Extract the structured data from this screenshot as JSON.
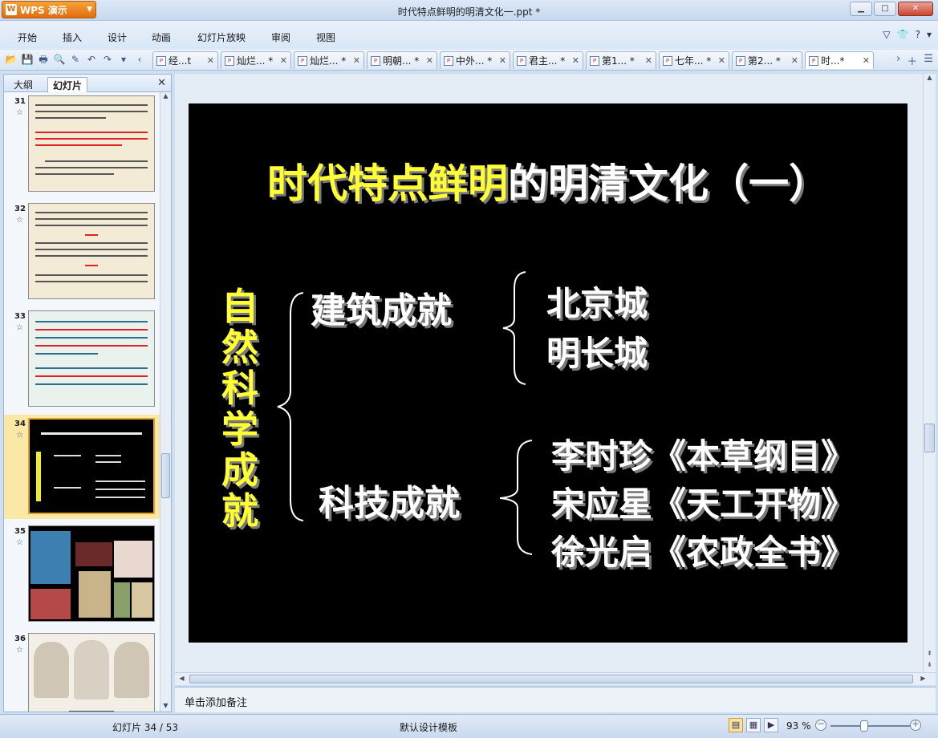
{
  "app": {
    "name": "WPS 演示",
    "document_title": "时代特点鲜明的明清文化一.ppt *"
  },
  "window_controls": {
    "minimize": "▁",
    "maximize": "□",
    "close": "✕"
  },
  "menu": [
    "开始",
    "插入",
    "设计",
    "动画",
    "幻灯片放映",
    "审阅",
    "视图"
  ],
  "doc_tabs": [
    {
      "label": "经...t",
      "active": false
    },
    {
      "label": "灿烂... *",
      "active": false
    },
    {
      "label": "灿烂... *",
      "active": false
    },
    {
      "label": "明朝... *",
      "active": false
    },
    {
      "label": "中外... *",
      "active": false
    },
    {
      "label": "君主... *",
      "active": false
    },
    {
      "label": "第1... *",
      "active": false
    },
    {
      "label": "七年... *",
      "active": false
    },
    {
      "label": "第2... *",
      "active": false
    },
    {
      "label": "时...*",
      "active": true
    }
  ],
  "left_panel": {
    "tabs": [
      "大纲",
      "幻灯片"
    ],
    "active_tab": "幻灯片",
    "thumbnails": [
      "31",
      "32",
      "33",
      "34",
      "35",
      "36"
    ],
    "selected": "34"
  },
  "slide": {
    "title_yellow": "时代特点鲜明",
    "title_white": "的明清文化（一）",
    "vertical_label": "自然科学成就",
    "branch1": "建筑成就",
    "branch1_items": [
      "北京城",
      "明长城"
    ],
    "branch2": "科技成就",
    "branch2_items": [
      "李时珍《本草纲目》",
      "宋应星《天工开物》",
      "徐光启《农政全书》"
    ]
  },
  "notes_placeholder": "单击添加备注",
  "status": {
    "slide_counter": "幻灯片 34 / 53",
    "template": "默认设计模板",
    "zoom": "93 %"
  }
}
